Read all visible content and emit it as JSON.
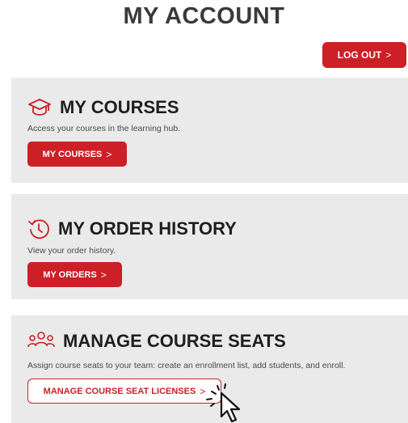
{
  "header": {
    "title": "MY ACCOUNT"
  },
  "logout": {
    "label": "LOG OUT",
    "chevron": ">"
  },
  "courses": {
    "icon": "graduation-cap-icon",
    "title": "MY COURSES",
    "description": "Access your courses in the learning hub.",
    "button_label": "MY COURSES",
    "chevron": ">"
  },
  "orders": {
    "icon": "history-clock-icon",
    "title": "MY ORDER HISTORY",
    "description": "View your order history.",
    "button_label": "MY ORDERS",
    "chevron": ">"
  },
  "seats": {
    "icon": "team-people-icon",
    "title": "MANAGE COURSE SEATS",
    "description": "Assign course seats to your team: create an enrollment list, add students, and enroll.",
    "button_label": "MANAGE COURSE SEAT LICENSES",
    "chevron": ">"
  },
  "colors": {
    "accent": "#cc1f26",
    "card_bg": "#eaeaea",
    "title": "#3a3a3a"
  }
}
